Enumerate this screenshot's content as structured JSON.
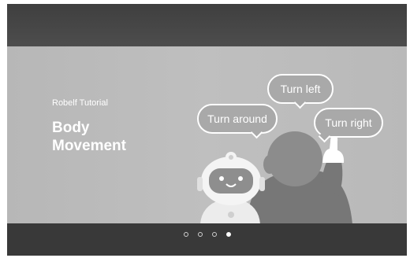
{
  "slide": {
    "subtitle": "Robelf Tutorial",
    "title": "Body Movement",
    "bubbles": {
      "around": "Turn around",
      "left": "Turn left",
      "right": "Turn right"
    }
  },
  "pagination": {
    "total": 4,
    "active_index": 4
  }
}
